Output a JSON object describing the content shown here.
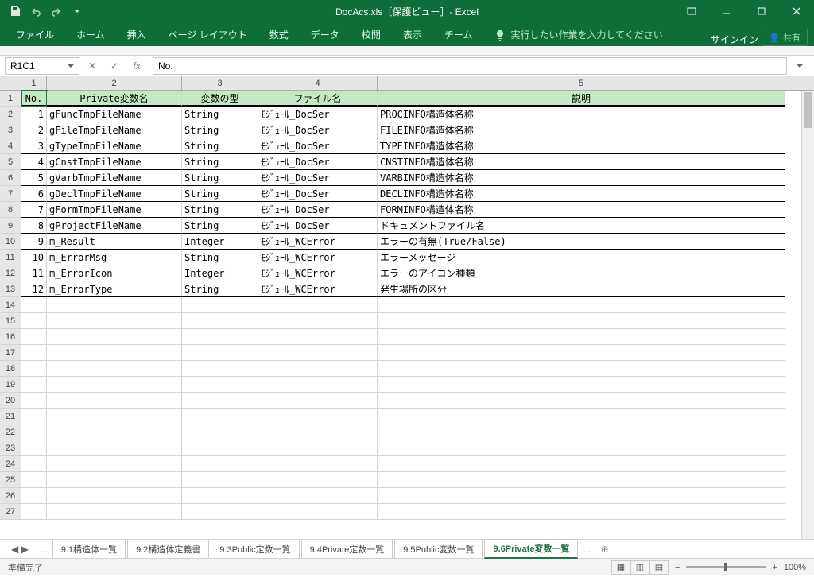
{
  "title": "DocAcs.xls［保護ビュー］- Excel",
  "qat": {
    "save": "save",
    "undo": "undo",
    "redo": "redo"
  },
  "tabs": {
    "file": "ファイル",
    "home": "ホーム",
    "insert": "挿入",
    "layout": "ページ レイアウト",
    "formula": "数式",
    "data": "データ",
    "review": "校閲",
    "view": "表示",
    "team": "チーム"
  },
  "tell": "実行したい作業を入力してください",
  "signin": "サインイン",
  "share": "共有",
  "namebox": "R1C1",
  "formula": "No.",
  "cols": {
    "c1": "1",
    "c2": "2",
    "c3": "3",
    "c4": "4",
    "c5": "5"
  },
  "widths": {
    "c1": 32,
    "c2": 170,
    "c3": 96,
    "c4": 150,
    "c5": 513
  },
  "headers": {
    "no": "No.",
    "name": "Private変数名",
    "type": "変数の型",
    "file": "ファイル名",
    "desc": "説明"
  },
  "data": [
    {
      "no": "1",
      "name": "gFuncTmpFileName",
      "type": "String",
      "file": "ﾓｼﾞｭｰﾙ_DocSer",
      "desc": "PROCINFO構造体名称"
    },
    {
      "no": "2",
      "name": "gFileTmpFileName",
      "type": "String",
      "file": "ﾓｼﾞｭｰﾙ_DocSer",
      "desc": "FILEINFO構造体名称"
    },
    {
      "no": "3",
      "name": "gTypeTmpFileName",
      "type": "String",
      "file": "ﾓｼﾞｭｰﾙ_DocSer",
      "desc": "TYPEINFO構造体名称"
    },
    {
      "no": "4",
      "name": "gCnstTmpFileName",
      "type": "String",
      "file": "ﾓｼﾞｭｰﾙ_DocSer",
      "desc": "CNSTINFO構造体名称"
    },
    {
      "no": "5",
      "name": "gVarbTmpFileName",
      "type": "String",
      "file": "ﾓｼﾞｭｰﾙ_DocSer",
      "desc": "VARBINFO構造体名称"
    },
    {
      "no": "6",
      "name": "gDeclTmpFileName",
      "type": "String",
      "file": "ﾓｼﾞｭｰﾙ_DocSer",
      "desc": "DECLINFO構造体名称"
    },
    {
      "no": "7",
      "name": "gFormTmpFileName",
      "type": "String",
      "file": "ﾓｼﾞｭｰﾙ_DocSer",
      "desc": "FORMINFO構造体名称"
    },
    {
      "no": "8",
      "name": "gProjectFileName",
      "type": "String",
      "file": "ﾓｼﾞｭｰﾙ_DocSer",
      "desc": "ドキュメントファイル名"
    },
    {
      "no": "9",
      "name": "m_Result",
      "type": "Integer",
      "file": "ﾓｼﾞｭｰﾙ_WCError",
      "desc": "エラーの有無(True/False)"
    },
    {
      "no": "10",
      "name": "m_ErrorMsg",
      "type": "String",
      "file": "ﾓｼﾞｭｰﾙ_WCError",
      "desc": "エラーメッセージ"
    },
    {
      "no": "11",
      "name": "m_ErrorIcon",
      "type": "Integer",
      "file": "ﾓｼﾞｭｰﾙ_WCError",
      "desc": "エラーのアイコン種類"
    },
    {
      "no": "12",
      "name": "m_ErrorType",
      "type": "String",
      "file": "ﾓｼﾞｭｰﾙ_WCError",
      "desc": "発生場所の区分"
    }
  ],
  "empty_rows": [
    "14",
    "15",
    "16",
    "17",
    "18",
    "19",
    "20",
    "21",
    "22",
    "23",
    "24",
    "25",
    "26",
    "27"
  ],
  "sheets": {
    "s1": "9.1構造体一覧",
    "s2": "9.2構造体定義書",
    "s3": "9.3Public定数一覧",
    "s4": "9.4Private定数一覧",
    "s5": "9.5Public変数一覧",
    "s6": "9.6Private変数一覧"
  },
  "status": "準備完了",
  "zoom": "100%"
}
